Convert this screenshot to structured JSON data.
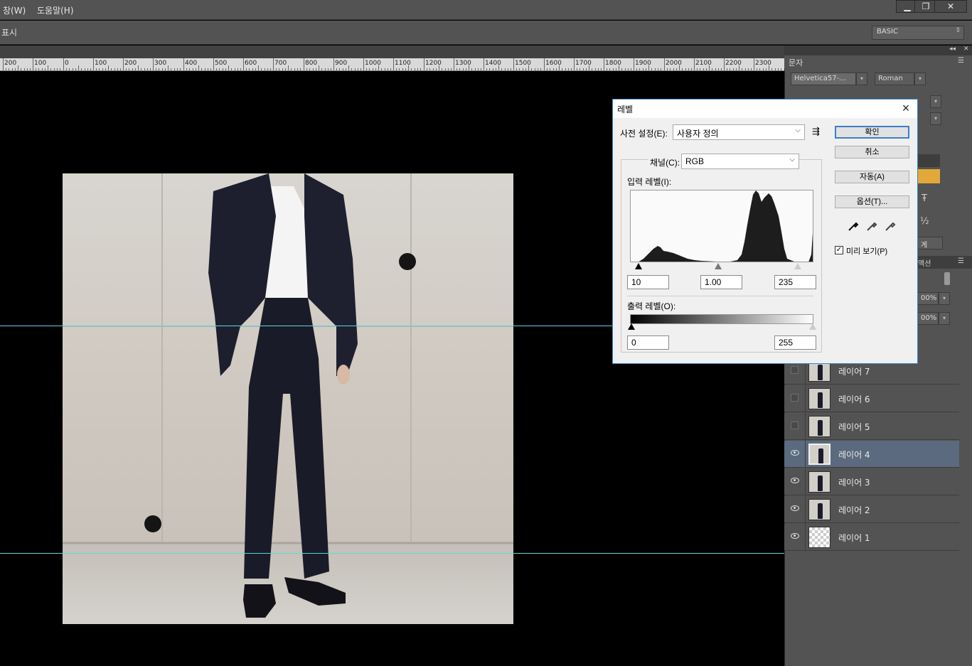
{
  "menu": {
    "window": "창(W)",
    "help": "도움말(H)"
  },
  "window_controls": {
    "minimize": "▁",
    "restore": "❐",
    "close": "✕"
  },
  "options_bar": {
    "show_label": "표시",
    "workspace": "BASIC"
  },
  "ruler": {
    "labels": [
      "200",
      "100",
      "0",
      "100",
      "200",
      "300",
      "400",
      "500",
      "600",
      "700",
      "800",
      "900",
      "1000",
      "1100",
      "1200",
      "1300",
      "1400",
      "1500",
      "1600",
      "1700",
      "1800",
      "1900",
      "2000",
      "2100",
      "2200",
      "2300"
    ]
  },
  "character_panel": {
    "tab_label": "문자",
    "font_family": "Helvetica57-...",
    "font_style": "Roman",
    "partial_percent_1": "00%",
    "partial_percent_2": "00%",
    "partial_text": "계",
    "partial_tab": "액션",
    "partial_fraction": "½",
    "accent_color": "#e3a83a"
  },
  "layers": [
    {
      "name": "레이어 7",
      "visible": false,
      "selected": false,
      "thumb": "photo"
    },
    {
      "name": "레이어 6",
      "visible": false,
      "selected": false,
      "thumb": "photo"
    },
    {
      "name": "레이어 5",
      "visible": false,
      "selected": false,
      "thumb": "photo"
    },
    {
      "name": "레이어 4",
      "visible": true,
      "selected": true,
      "thumb": "photo"
    },
    {
      "name": "레이어 3",
      "visible": true,
      "selected": false,
      "thumb": "photo"
    },
    {
      "name": "레이어 2",
      "visible": true,
      "selected": false,
      "thumb": "photo"
    },
    {
      "name": "레이어 1",
      "visible": true,
      "selected": false,
      "thumb": "transparent"
    }
  ],
  "levels_dialog": {
    "title": "레벨",
    "preset_label": "사전 설정(E):",
    "preset_value": "사용자 정의",
    "channel_label": "채널(C):",
    "channel_value": "RGB",
    "input_levels_label": "입력 레벨(I):",
    "input_black": "10",
    "input_gamma": "1.00",
    "input_white": "235",
    "output_levels_label": "출력 레벨(O):",
    "output_black": "0",
    "output_white": "255",
    "buttons": {
      "ok": "확인",
      "cancel": "취소",
      "auto": "자동(A)",
      "options": "옵션(T)..."
    },
    "preview_label": "미리 보기(P)",
    "preview_checked": "✓"
  }
}
